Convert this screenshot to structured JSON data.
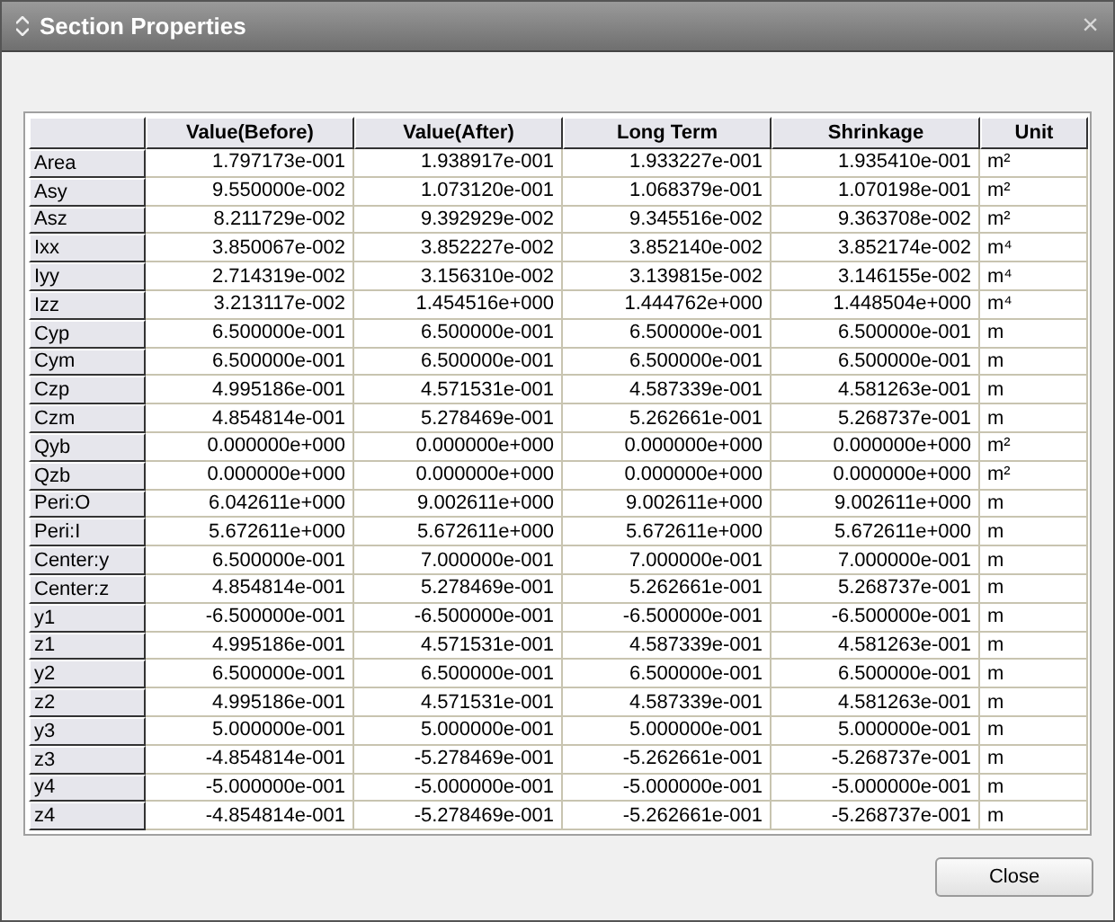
{
  "window": {
    "title": "Section Properties",
    "close_glyph": "×"
  },
  "table": {
    "columns": [
      "Value(Before)",
      "Value(After)",
      "Long Term",
      "Shrinkage",
      "Unit"
    ],
    "rows": [
      {
        "name": "Area",
        "cells": [
          "1.797173e-001",
          "1.938917e-001",
          "1.933227e-001",
          "1.935410e-001",
          "m²"
        ]
      },
      {
        "name": "Asy",
        "cells": [
          "9.550000e-002",
          "1.073120e-001",
          "1.068379e-001",
          "1.070198e-001",
          "m²"
        ]
      },
      {
        "name": "Asz",
        "cells": [
          "8.211729e-002",
          "9.392929e-002",
          "9.345516e-002",
          "9.363708e-002",
          "m²"
        ]
      },
      {
        "name": "Ixx",
        "cells": [
          "3.850067e-002",
          "3.852227e-002",
          "3.852140e-002",
          "3.852174e-002",
          "m⁴"
        ]
      },
      {
        "name": "Iyy",
        "cells": [
          "2.714319e-002",
          "3.156310e-002",
          "3.139815e-002",
          "3.146155e-002",
          "m⁴"
        ]
      },
      {
        "name": "Izz",
        "cells": [
          "3.213117e-002",
          "1.454516e+000",
          "1.444762e+000",
          "1.448504e+000",
          "m⁴"
        ]
      },
      {
        "name": "Cyp",
        "cells": [
          "6.500000e-001",
          "6.500000e-001",
          "6.500000e-001",
          "6.500000e-001",
          "m"
        ]
      },
      {
        "name": "Cym",
        "cells": [
          "6.500000e-001",
          "6.500000e-001",
          "6.500000e-001",
          "6.500000e-001",
          "m"
        ]
      },
      {
        "name": "Czp",
        "cells": [
          "4.995186e-001",
          "4.571531e-001",
          "4.587339e-001",
          "4.581263e-001",
          "m"
        ]
      },
      {
        "name": "Czm",
        "cells": [
          "4.854814e-001",
          "5.278469e-001",
          "5.262661e-001",
          "5.268737e-001",
          "m"
        ]
      },
      {
        "name": "Qyb",
        "cells": [
          "0.000000e+000",
          "0.000000e+000",
          "0.000000e+000",
          "0.000000e+000",
          "m²"
        ]
      },
      {
        "name": "Qzb",
        "cells": [
          "0.000000e+000",
          "0.000000e+000",
          "0.000000e+000",
          "0.000000e+000",
          "m²"
        ]
      },
      {
        "name": "Peri:O",
        "cells": [
          "6.042611e+000",
          "9.002611e+000",
          "9.002611e+000",
          "9.002611e+000",
          "m"
        ]
      },
      {
        "name": "Peri:I",
        "cells": [
          "5.672611e+000",
          "5.672611e+000",
          "5.672611e+000",
          "5.672611e+000",
          "m"
        ]
      },
      {
        "name": "Center:y",
        "cells": [
          "6.500000e-001",
          "7.000000e-001",
          "7.000000e-001",
          "7.000000e-001",
          "m"
        ]
      },
      {
        "name": "Center:z",
        "cells": [
          "4.854814e-001",
          "5.278469e-001",
          "5.262661e-001",
          "5.268737e-001",
          "m"
        ]
      },
      {
        "name": "y1",
        "cells": [
          "-6.500000e-001",
          "-6.500000e-001",
          "-6.500000e-001",
          "-6.500000e-001",
          "m"
        ]
      },
      {
        "name": "z1",
        "cells": [
          "4.995186e-001",
          "4.571531e-001",
          "4.587339e-001",
          "4.581263e-001",
          "m"
        ]
      },
      {
        "name": "y2",
        "cells": [
          "6.500000e-001",
          "6.500000e-001",
          "6.500000e-001",
          "6.500000e-001",
          "m"
        ]
      },
      {
        "name": "z2",
        "cells": [
          "4.995186e-001",
          "4.571531e-001",
          "4.587339e-001",
          "4.581263e-001",
          "m"
        ]
      },
      {
        "name": "y3",
        "cells": [
          "5.000000e-001",
          "5.000000e-001",
          "5.000000e-001",
          "5.000000e-001",
          "m"
        ]
      },
      {
        "name": "z3",
        "cells": [
          "-4.854814e-001",
          "-5.278469e-001",
          "-5.262661e-001",
          "-5.268737e-001",
          "m"
        ]
      },
      {
        "name": "y4",
        "cells": [
          "-5.000000e-001",
          "-5.000000e-001",
          "-5.000000e-001",
          "-5.000000e-001",
          "m"
        ]
      },
      {
        "name": "z4",
        "cells": [
          "-4.854814e-001",
          "-5.278469e-001",
          "-5.262661e-001",
          "-5.268737e-001",
          "m"
        ]
      }
    ]
  },
  "buttons": [
    "Close"
  ]
}
